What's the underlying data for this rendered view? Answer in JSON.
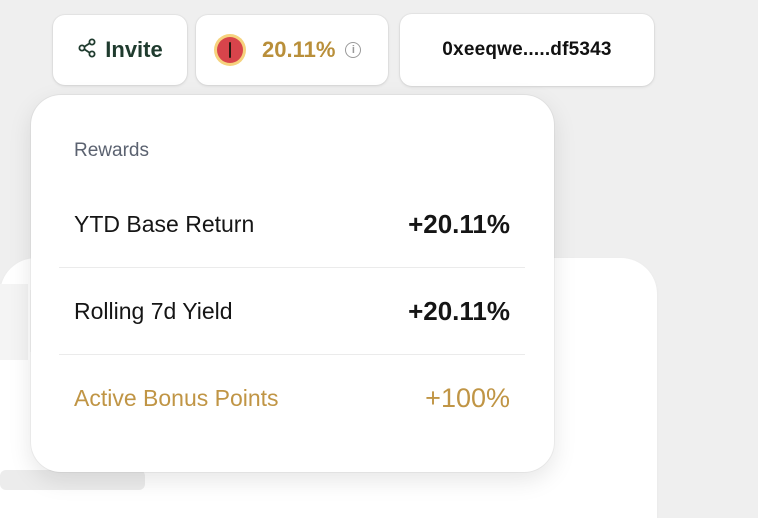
{
  "header": {
    "invite_label": "Invite",
    "yield_value": "20.11%",
    "info_glyph": "i",
    "wallet_address": "0xeeqwe.....df5343"
  },
  "rewards": {
    "title": "Rewards",
    "rows": [
      {
        "label": "YTD Base Return",
        "value": "+20.11%"
      },
      {
        "label": "Rolling 7d Yield",
        "value": "+20.11%"
      },
      {
        "label": "Active Bonus Points",
        "value": "+100%"
      }
    ]
  },
  "colors": {
    "accent_gold": "#b98f3a",
    "invite_text": "#1f3b2e",
    "logo_red": "#d8444b",
    "logo_ring": "#f6d27d"
  },
  "icons": {
    "invite": "share-icon",
    "yield": "token-logo-icon",
    "info": "info-icon"
  }
}
